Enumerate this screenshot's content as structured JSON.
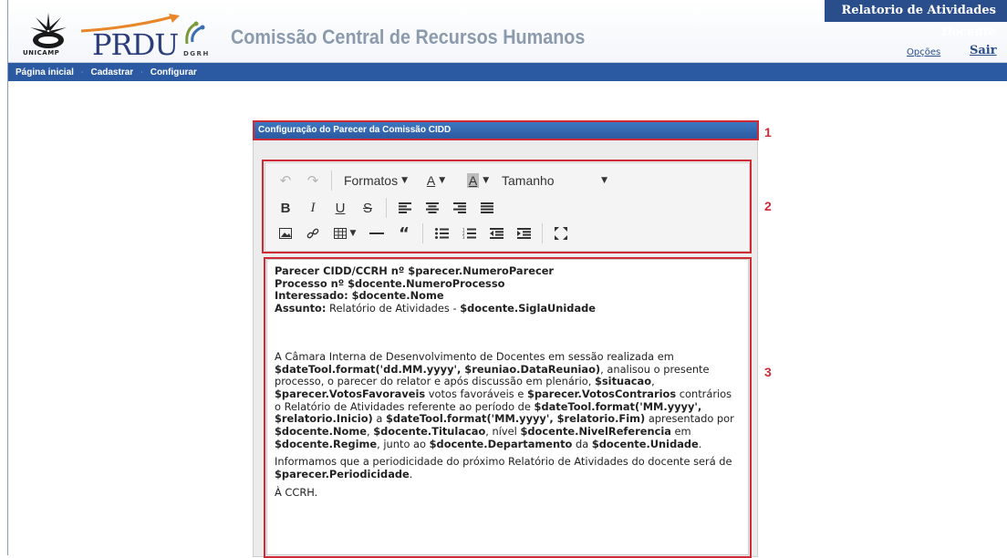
{
  "header": {
    "unicamp_label": "UNICAMP",
    "prdu_label": "PRDU",
    "dgrh_label": "DGRH",
    "app_title": "Comissão Central de Recursos Humanos",
    "system_title": "Relatorio de Atividades Docente",
    "options_link": "Opções",
    "logout_link": "Sair"
  },
  "nav": {
    "items": [
      "Página inicial",
      "Cadastrar",
      "Configurar"
    ]
  },
  "panel": {
    "title": "Configuração do Parecer da Comissão CIDD"
  },
  "toolbar": {
    "formats_label": "Formatos",
    "size_label": "Tamanho",
    "font_color_glyph": "A",
    "bg_color_glyph": "A"
  },
  "editor": {
    "l1": "Parecer CIDD/CCRH nº $parecer.NumeroParecer",
    "l2": "Processo nº $docente.NumeroProcesso",
    "l3": "Interessado: $docente.Nome",
    "l4_label": "Assunto:",
    "l4_text": " Relatório de Atividades - ",
    "l4_var": "$docente.SiglaUnidade",
    "p1": [
      {
        "t": "A Câmara Interna de Desenvolvimento de Docentes em sessão realizada em ",
        "b": false
      },
      {
        "t": "$dateTool.format('dd.MM.yyyy', $reuniao.DataReuniao)",
        "b": true
      },
      {
        "t": ", analisou o presente processo, o parecer do relator e após discussão em plenário, ",
        "b": false
      },
      {
        "t": "$situacao",
        "b": true
      },
      {
        "t": ", ",
        "b": false
      },
      {
        "t": "$parecer.VotosFavoraveis",
        "b": true
      },
      {
        "t": " votos favoráveis e ",
        "b": false
      },
      {
        "t": "$parecer.VotosContrarios",
        "b": true
      },
      {
        "t": " contrários o Relatório de Atividades referente ao período de ",
        "b": false
      },
      {
        "t": "$dateTool.format('MM.yyyy', $relatorio.Inicio)",
        "b": true
      },
      {
        "t": " a ",
        "b": false
      },
      {
        "t": "$dateTool.format('MM.yyyy', $relatorio.Fim)",
        "b": true
      },
      {
        "t": " apresentado por ",
        "b": false
      },
      {
        "t": "$docente.Nome",
        "b": true
      },
      {
        "t": ", ",
        "b": false
      },
      {
        "t": "$docente.Titulacao",
        "b": true
      },
      {
        "t": ", nível ",
        "b": false
      },
      {
        "t": "$docente.NivelReferencia",
        "b": true
      },
      {
        "t": " em ",
        "b": false
      },
      {
        "t": "$docente.Regime",
        "b": true
      },
      {
        "t": ", junto ao ",
        "b": false
      },
      {
        "t": "$docente.Departamento",
        "b": true
      },
      {
        "t": " da ",
        "b": false
      },
      {
        "t": "$docente.Unidade",
        "b": true
      },
      {
        "t": ".",
        "b": false
      }
    ],
    "p2": [
      {
        "t": "Informamos que a periodicidade do próximo Relatório de Atividades do docente será de ",
        "b": false
      },
      {
        "t": "$parecer.Periodicidade",
        "b": true
      },
      {
        "t": ".",
        "b": false
      }
    ],
    "p3": "À CCRH."
  },
  "annotations": [
    "1",
    "2",
    "3"
  ],
  "colors": {
    "nav_bg": "#2b5aa3",
    "header_bar": "#3d77c0",
    "annotation_red": "#cf2a36",
    "title_gray": "#8c9aad"
  }
}
